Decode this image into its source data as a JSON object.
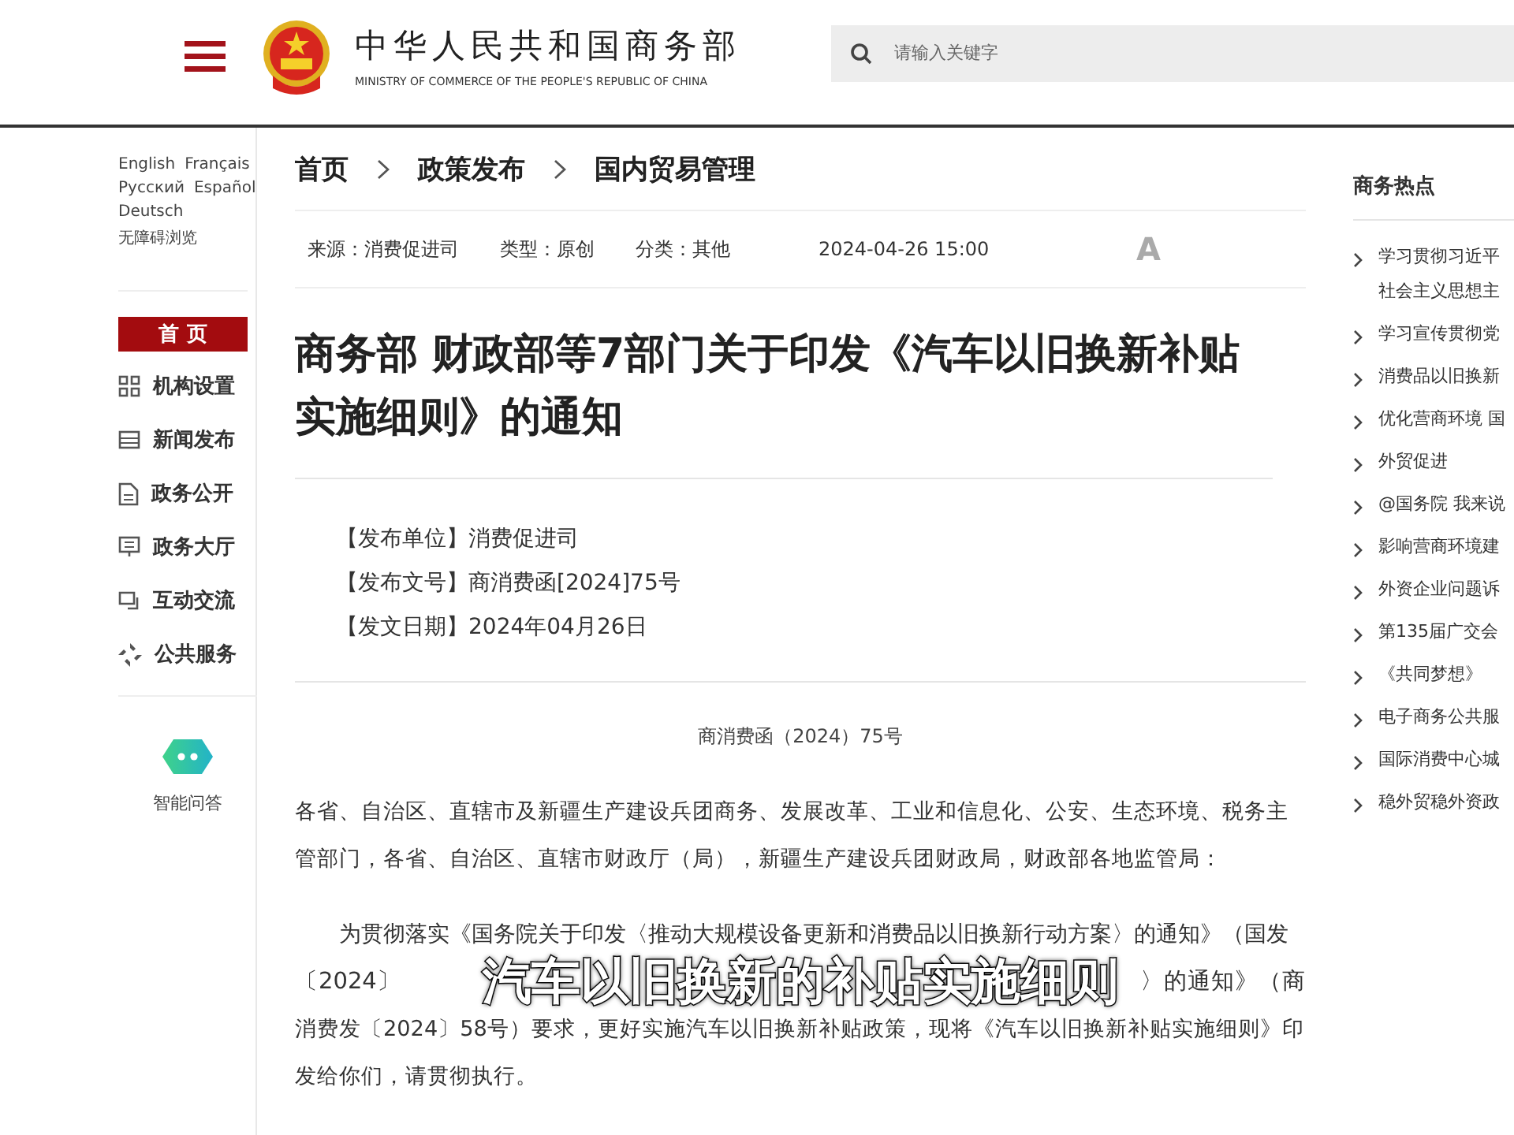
{
  "header": {
    "org_name": "中华人民共和国商务部",
    "org_name_en": "MINISTRY OF COMMERCE OF THE PEOPLE'S REPUBLIC OF CHINA",
    "search": {
      "placeholder": "请输入关键字"
    }
  },
  "languages": [
    [
      "English",
      "Français"
    ],
    [
      "Русский",
      "Español"
    ],
    [
      "Deutsch"
    ],
    [
      "无障碍浏览"
    ]
  ],
  "sidebar": {
    "items": [
      {
        "label": "首 页",
        "kind": "home",
        "selected": true
      },
      {
        "label": "机构设置",
        "kind": "grid",
        "selected": false
      },
      {
        "label": "新闻发布",
        "kind": "news",
        "selected": false
      },
      {
        "label": "政务公开",
        "kind": "doc",
        "selected": false
      },
      {
        "label": "政务大厅",
        "kind": "screen",
        "selected": false
      },
      {
        "label": "互动交流",
        "kind": "chat",
        "selected": false
      },
      {
        "label": "公共服务",
        "kind": "service",
        "selected": false
      }
    ],
    "assistant": "智能问答"
  },
  "breadcrumb": [
    "首页",
    "政策发布",
    "国内贸易管理"
  ],
  "meta": {
    "items": [
      "来源：消费促进司",
      "类型：原创",
      "分类：其他"
    ],
    "time": "2024-04-26 15:00",
    "font_size_button": "A"
  },
  "article": {
    "title": "商务部 财政部等7部门关于印发《汽车以旧换新补贴实施细则》的通知",
    "info": [
      "【发布单位】消费促进司",
      "【发布文号】商消费函[2024]75号",
      "【发文日期】2024年04月26日"
    ],
    "doc_number": "商消费函（2024）75号",
    "paragraph_1": "各省、自治区、直辖市及新疆生产建设兵团商务、发展改革、工业和信息化、公安、生态环境、税务主管部门，各省、自治区、直辖市财政厅（局），新疆生产建设兵团财政局，财政部各地监管局：",
    "paragraph_2_line_1": "为贯彻落实《国务院关于印发〈推动大规模设备更新和消费品以旧换新行动方案〉的通知》（国发",
    "paragraph_2_line_2_left": "〔2024〕",
    "paragraph_2_line_2_right": "〉的通知》（商",
    "paragraph_2_rest": "消费发〔2024〕58号）要求，更好实施汽车以旧换新补贴政策，现将《汽车以旧换新补贴实施细则》印发给你们，请贯彻执行。"
  },
  "hot_topics": {
    "title": "商务热点",
    "items": [
      [
        "学习贯彻习近平",
        "社会主义思想主"
      ],
      [
        "学习宣传贯彻党"
      ],
      [
        "消费品以旧换新"
      ],
      [
        "优化营商环境 国"
      ],
      [
        "外贸促进"
      ],
      [
        "@国务院 我来说"
      ],
      [
        "影响营商环境建"
      ],
      [
        "外资企业问题诉"
      ],
      [
        "第135届广交会"
      ],
      [
        "《共同梦想》"
      ],
      [
        "电子商务公共服"
      ],
      [
        "国际消费中心城"
      ],
      [
        "稳外贸稳外资政"
      ]
    ]
  },
  "caption": "汽车以旧换新的补贴实施细则"
}
